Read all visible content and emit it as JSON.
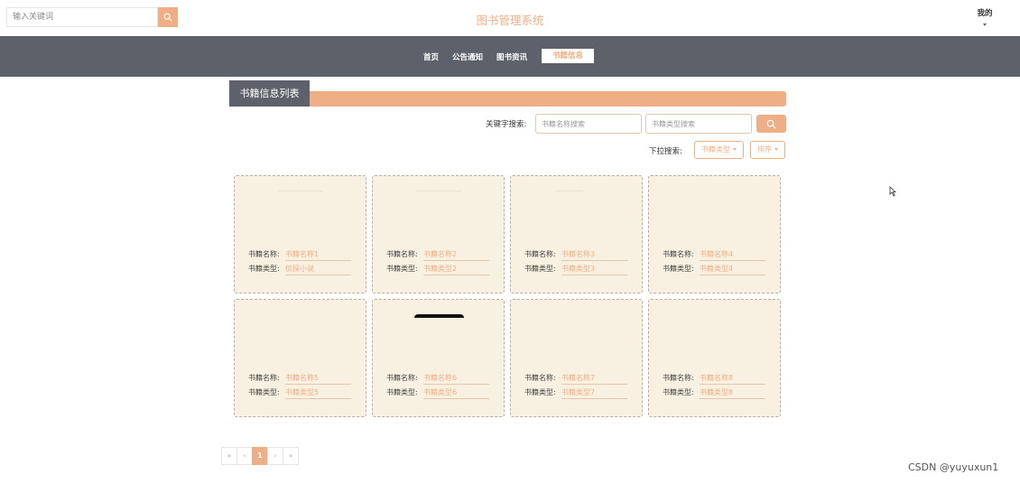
{
  "header": {
    "search_placeholder": "输入关键词",
    "site_title": "图书管理系统",
    "user_menu_label": "我的"
  },
  "nav": {
    "items": [
      {
        "label": "首页"
      },
      {
        "label": "公告通知"
      },
      {
        "label": "图书资讯"
      },
      {
        "label": "书籍信息",
        "active": true
      }
    ]
  },
  "section": {
    "title": "书籍信息列表"
  },
  "filters": {
    "keyword_label": "关键字搜索:",
    "name_placeholder": "书籍名称搜索",
    "type_placeholder": "书籍类型搜索",
    "dropdown_label": "下拉搜索:",
    "type_dropdown": "书籍类型",
    "sort_dropdown": "排序"
  },
  "books": [
    {
      "name_label": "书籍名称:",
      "name": "书籍名称1",
      "type_label": "书籍类型:",
      "type": "侦探小说"
    },
    {
      "name_label": "书籍名称:",
      "name": "书籍名称2",
      "type_label": "书籍类型:",
      "type": "书籍类型2"
    },
    {
      "name_label": "书籍名称:",
      "name": "书籍名称3",
      "type_label": "书籍类型:",
      "type": "书籍类型3"
    },
    {
      "name_label": "书籍名称:",
      "name": "书籍名称4",
      "type_label": "书籍类型:",
      "type": "书籍类型4"
    },
    {
      "name_label": "书籍名称:",
      "name": "书籍名称5",
      "type_label": "书籍类型:",
      "type": "书籍类型5"
    },
    {
      "name_label": "书籍名称:",
      "name": "书籍名称6",
      "type_label": "书籍类型:",
      "type": "书籍类型6"
    },
    {
      "name_label": "书籍名称:",
      "name": "书籍名称7",
      "type_label": "书籍类型:",
      "type": "书籍类型7"
    },
    {
      "name_label": "书籍名称:",
      "name": "书籍名称8",
      "type_label": "书籍类型:",
      "type": "书籍类型8"
    }
  ],
  "pagination": {
    "first": "«",
    "prev": "‹",
    "current": "1",
    "next": "›",
    "last": "»"
  },
  "watermark": "CSDN @yuyuxun1",
  "colors": {
    "accent": "#eeaf87",
    "nav_bg": "#5d6169",
    "card_bg": "#f8f0e0"
  }
}
